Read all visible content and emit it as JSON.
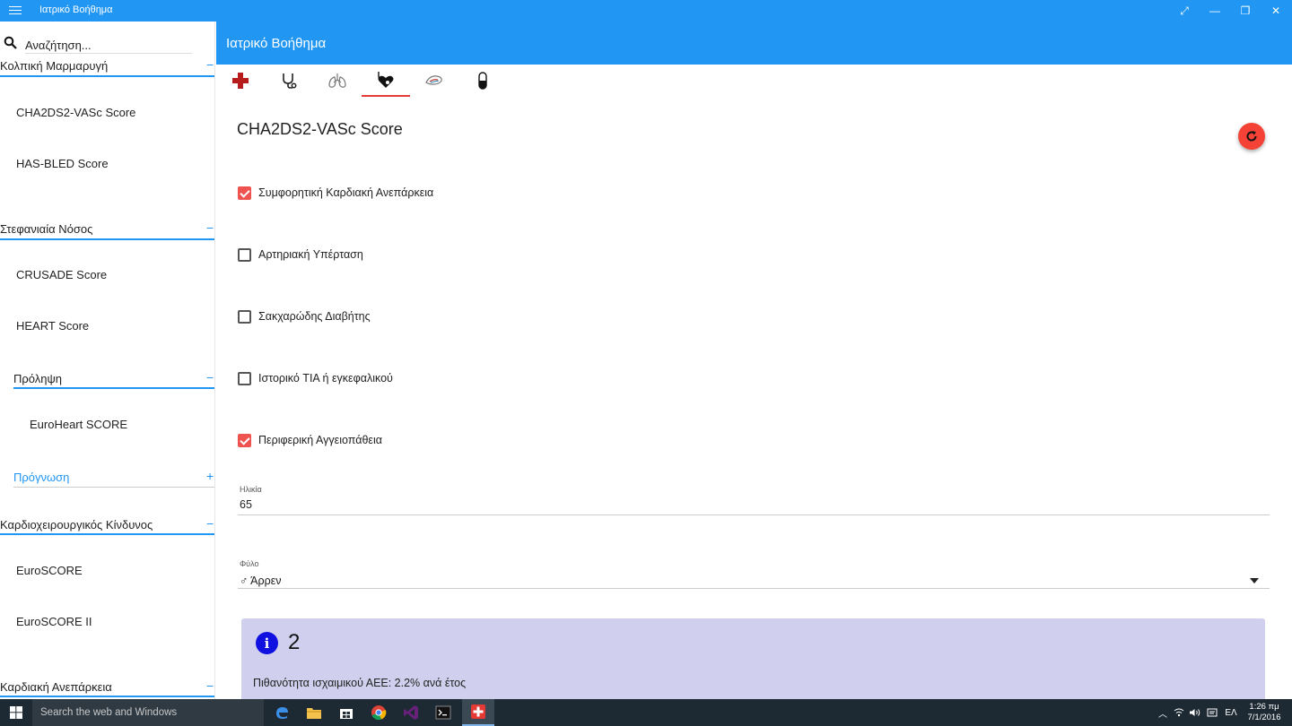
{
  "window": {
    "title": "Ιατρικό Βοήθημα"
  },
  "search": {
    "placeholder": "Αναζήτηση..."
  },
  "sidebar": {
    "groups": [
      {
        "title": "Κολπική Μαρμαρυγή",
        "toggle": "−",
        "items": [
          "CHA2DS2-VASc Score",
          "HAS-BLED Score"
        ]
      },
      {
        "title": "Στεφανιαία Νόσος",
        "toggle": "−",
        "items": [
          "CRUSADE Score",
          "HEART Score"
        ]
      },
      {
        "title": "Πρόληψη",
        "toggle": "−",
        "items": [
          "EuroHeart SCORE"
        ]
      },
      {
        "title": "Πρόγνωση",
        "toggle": "+",
        "items": []
      },
      {
        "title": "Καρδιοχειρουργικός Κίνδυνος",
        "toggle": "−",
        "items": [
          "EuroSCORE",
          "EuroSCORE II"
        ]
      },
      {
        "title": "Καρδιακή Ανεπάρκεια",
        "toggle": "−",
        "items": []
      }
    ]
  },
  "header": {
    "title": "Ιατρικό Βοήθημα"
  },
  "tabs": [
    {
      "icon": "red-cross-icon",
      "active": false
    },
    {
      "icon": "stethoscope-icon",
      "active": false
    },
    {
      "icon": "lungs-icon",
      "active": false
    },
    {
      "icon": "heart-stethoscope-icon",
      "active": true
    },
    {
      "icon": "kidney-icon",
      "active": false
    },
    {
      "icon": "pill-icon",
      "active": false
    }
  ],
  "calculator": {
    "title": "CHA2DS2-VASc Score",
    "reset_icon": "refresh-icon",
    "criteria": [
      {
        "label": "Συμφορητική Καρδιακή Ανεπάρκεια",
        "checked": true
      },
      {
        "label": "Αρτηριακή Υπέρταση",
        "checked": false
      },
      {
        "label": "Σακχαρώδης Διαβήτης",
        "checked": false
      },
      {
        "label": "Ιστορικό TIA ή εγκεφαλικού",
        "checked": false
      },
      {
        "label": "Περιφερική Αγγειοπάθεια",
        "checked": true
      }
    ],
    "age": {
      "label": "Ηλικία",
      "value": "65"
    },
    "sex": {
      "label": "Φύλο",
      "value": "♂ Άρρεν"
    },
    "result": {
      "score": "2",
      "description": "Πιθανότητα ισχαιμικού ΑΕΕ: 2.2% ανά έτος"
    }
  },
  "colors": {
    "accent": "#2196f3",
    "checked": "#ef5350",
    "fab": "#f44336",
    "result_bg": "#d0d0ee"
  },
  "taskbar": {
    "search_placeholder": "Search the web and Windows",
    "language": "ΕΛ",
    "time": "1:26 πμ",
    "date": "7/1/2016"
  }
}
